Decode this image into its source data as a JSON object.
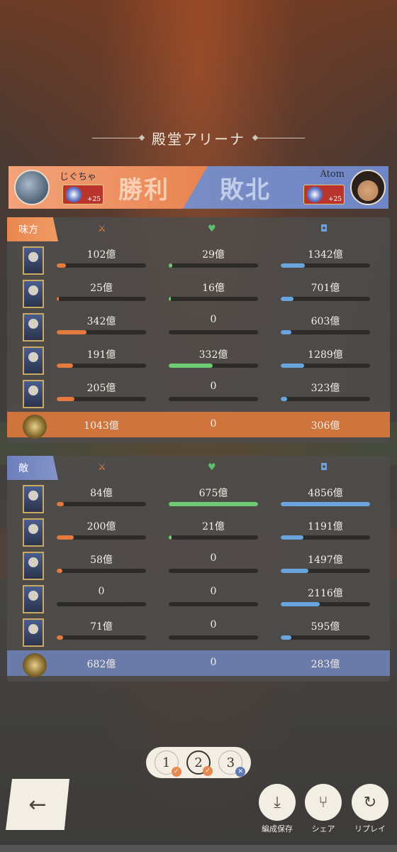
{
  "title": "殿堂アリーナ",
  "banner": {
    "left_player": "じぐちゃ",
    "right_player": "Atom",
    "left_badge": "+25",
    "right_badge": "+25",
    "win_label": "勝利",
    "lose_label": "敗北"
  },
  "ally": {
    "tag": "味方",
    "rows": [
      {
        "atk": "102億",
        "heal": "29億",
        "def": "1342億",
        "atk_f": 0.1,
        "heal_f": 0.04,
        "def_f": 0.27
      },
      {
        "atk": "25億",
        "heal": "16億",
        "def": "701億",
        "atk_f": 0.02,
        "heal_f": 0.02,
        "def_f": 0.14
      },
      {
        "atk": "342億",
        "heal": "0",
        "def": "603億",
        "atk_f": 0.33,
        "heal_f": 0,
        "def_f": 0.12
      },
      {
        "atk": "191億",
        "heal": "332億",
        "def": "1289億",
        "atk_f": 0.18,
        "heal_f": 0.49,
        "def_f": 0.26
      },
      {
        "atk": "205億",
        "heal": "0",
        "def": "323億",
        "atk_f": 0.2,
        "heal_f": 0,
        "def_f": 0.07
      }
    ],
    "total": {
      "atk": "1043億",
      "heal": "0",
      "def": "306億"
    }
  },
  "enemy": {
    "tag": "敵",
    "rows": [
      {
        "atk": "84億",
        "heal": "675億",
        "def": "4856億",
        "atk_f": 0.08,
        "heal_f": 1.0,
        "def_f": 1.0
      },
      {
        "atk": "200億",
        "heal": "21億",
        "def": "1191億",
        "atk_f": 0.19,
        "heal_f": 0.03,
        "def_f": 0.25
      },
      {
        "atk": "58億",
        "heal": "0",
        "def": "1497億",
        "atk_f": 0.06,
        "heal_f": 0,
        "def_f": 0.31
      },
      {
        "atk": "0",
        "heal": "0",
        "def": "2116億",
        "atk_f": 0,
        "heal_f": 0,
        "def_f": 0.44
      },
      {
        "atk": "71億",
        "heal": "0",
        "def": "595億",
        "atk_f": 0.07,
        "heal_f": 0,
        "def_f": 0.12
      }
    ],
    "total": {
      "atk": "682億",
      "heal": "0",
      "def": "283億"
    }
  },
  "rounds": [
    {
      "label": "1",
      "status": "win"
    },
    {
      "label": "2",
      "status": "win"
    },
    {
      "label": "3",
      "status": "lose"
    }
  ],
  "actions": {
    "save_label": "編成保存",
    "share_label": "シェア",
    "replay_label": "リプレイ"
  }
}
